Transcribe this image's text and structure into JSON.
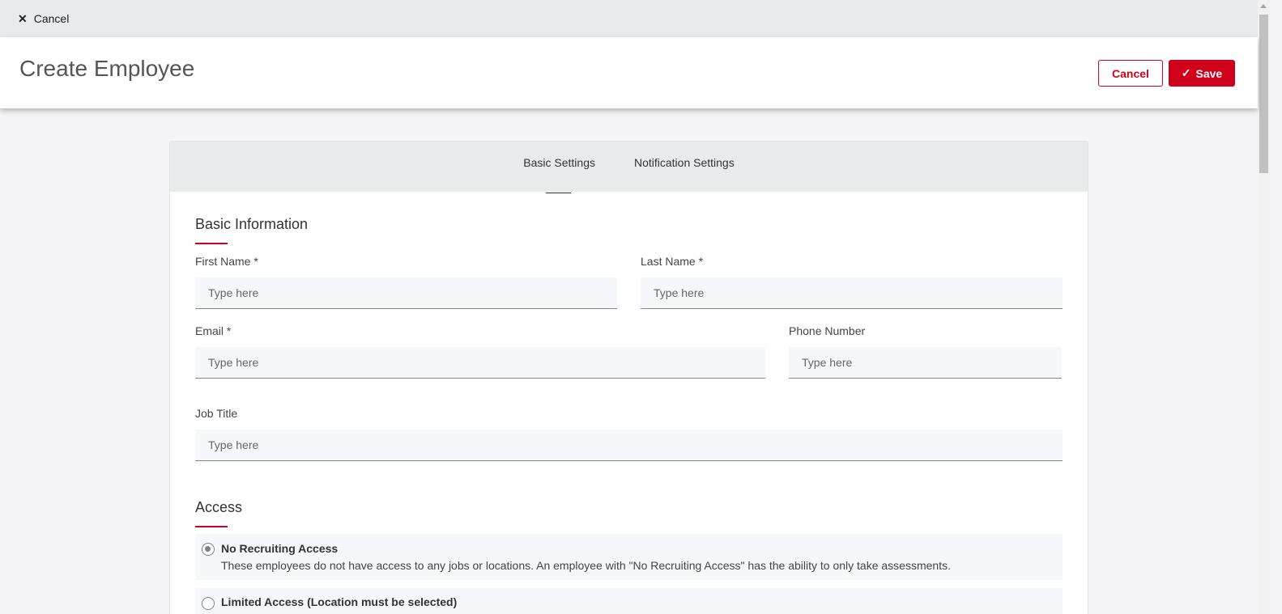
{
  "topbar": {
    "cancel_label": "Cancel",
    "close_glyph": "✕"
  },
  "header": {
    "title": "Create Employee",
    "cancel_label": "Cancel",
    "save_label": "Save",
    "check_glyph": "✓"
  },
  "tabs": [
    {
      "label": "Basic Settings",
      "active": true
    },
    {
      "label": "Notification Settings",
      "active": false
    }
  ],
  "basic_information": {
    "title": "Basic Information",
    "first_name": {
      "label": "First Name *",
      "placeholder": "Type here",
      "value": ""
    },
    "last_name": {
      "label": "Last Name *",
      "placeholder": "Type here",
      "value": ""
    },
    "email": {
      "label": "Email *",
      "placeholder": "Type here",
      "value": ""
    },
    "phone": {
      "label": "Phone Number",
      "placeholder": "Type here",
      "value": ""
    },
    "job_title": {
      "label": "Job Title",
      "placeholder": "Type here",
      "value": ""
    }
  },
  "access": {
    "title": "Access",
    "options": [
      {
        "title": "No Recruiting Access",
        "description": "These employees do not have access to any jobs or locations. An employee with \"No Recruiting Access\" has the ability to only take assessments.",
        "selected": true
      },
      {
        "title": "Limited Access (Location must be selected)",
        "description": "",
        "selected": false
      }
    ]
  },
  "colors": {
    "accent": "#d0021b",
    "topbar": "#e9eaed",
    "page_bg": "#f4f4f6",
    "input_bg": "#f6f7fb"
  }
}
